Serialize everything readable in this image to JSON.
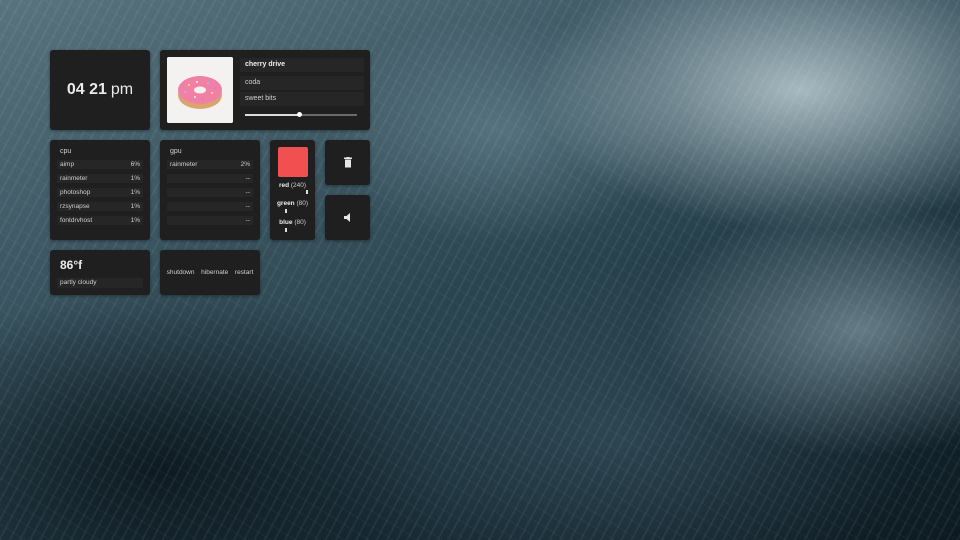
{
  "clock": {
    "hour": "04",
    "minute": "21",
    "ampm": "pm"
  },
  "music": {
    "track": "cherry drive",
    "artist": "coda",
    "album": "sweet bits",
    "progress": 0.48,
    "art_icon": "donut-album-art"
  },
  "cpu": {
    "title": "cpu",
    "rows": [
      {
        "name": "aimp",
        "value": "6%"
      },
      {
        "name": "rainmeter",
        "value": "1%"
      },
      {
        "name": "photoshop",
        "value": "1%"
      },
      {
        "name": "rzsynapse",
        "value": "1%"
      },
      {
        "name": "fontdrvhost",
        "value": "1%"
      }
    ]
  },
  "gpu": {
    "title": "gpu",
    "rows": [
      {
        "name": "rainmeter",
        "value": "2%"
      },
      {
        "name": "",
        "value": "--"
      },
      {
        "name": "",
        "value": "--"
      },
      {
        "name": "",
        "value": "--"
      },
      {
        "name": "",
        "value": "--"
      }
    ]
  },
  "mixer": {
    "swatch_color": "#f05050",
    "red": {
      "label": "red",
      "value": "(240)",
      "level": 240
    },
    "green": {
      "label": "green",
      "value": "(80)",
      "level": 80
    },
    "blue": {
      "label": "blue",
      "value": "(80)",
      "level": 80
    }
  },
  "buttons": {
    "trash_icon": "trash-icon",
    "volume_icon": "volume-icon"
  },
  "weather": {
    "temp": "86°f",
    "condition": "partly cloudy"
  },
  "power": {
    "shutdown": "shutdown",
    "hibernate": "hibernate",
    "restart": "restart"
  },
  "colors": {
    "panel": "#1f1f1f",
    "row": "#262626",
    "accent": "#f05050"
  }
}
